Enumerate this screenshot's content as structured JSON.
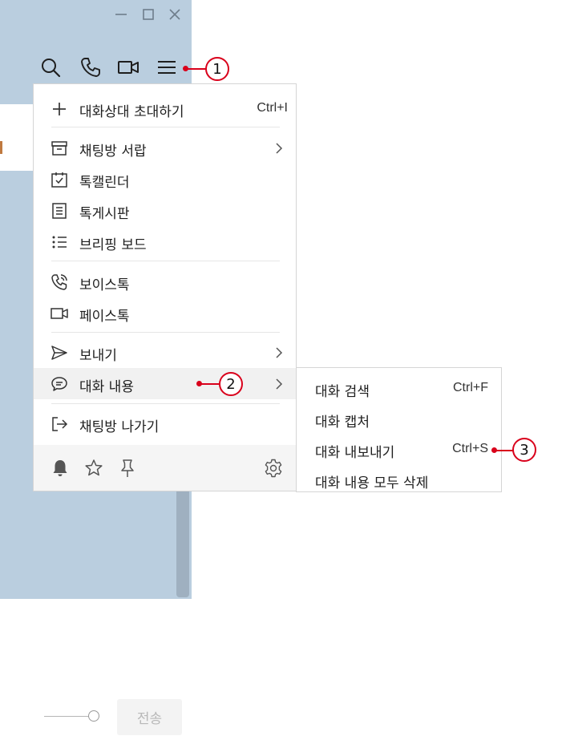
{
  "window_controls": {
    "minimize_icon": "minimize-icon",
    "maximize_icon": "maximize-icon",
    "close_icon": "close-icon"
  },
  "toolbar": {
    "icons": [
      "search-icon",
      "phone-icon",
      "video-icon",
      "hamburger-menu-icon"
    ]
  },
  "callouts": {
    "c1": "1",
    "c2": "2",
    "c3": "3",
    "color": "#d9001b"
  },
  "menu": {
    "invite": {
      "label": "대화상대 초대하기",
      "shortcut": "Ctrl+I"
    },
    "drawer": {
      "label": "채팅방 서랍"
    },
    "calendar": {
      "label": "톡캘린더"
    },
    "board": {
      "label": "톡게시판"
    },
    "briefing": {
      "label": "브리핑 보드"
    },
    "voice": {
      "label": "보이스톡"
    },
    "face": {
      "label": "페이스톡"
    },
    "send": {
      "label": "보내기"
    },
    "conversation": {
      "label": "대화 내용"
    },
    "leave": {
      "label": "채팅방 나가기"
    },
    "footer_icons": [
      "bell-icon",
      "star-icon",
      "pin-icon",
      "settings-gear-icon"
    ]
  },
  "submenu": {
    "search": {
      "label": "대화 검색",
      "shortcut": "Ctrl+F"
    },
    "capture": {
      "label": "대화 캡처"
    },
    "export": {
      "label": "대화 내보내기",
      "shortcut": "Ctrl+S"
    },
    "delete_all": {
      "label": "대화 내용 모두 삭제"
    }
  },
  "composer": {
    "send_label": "전송"
  },
  "colors": {
    "window_bg": "#bacedf",
    "hover_bg": "#f1f1f1",
    "footer_bg": "#f5f5f5",
    "accent": "#d9001b"
  }
}
